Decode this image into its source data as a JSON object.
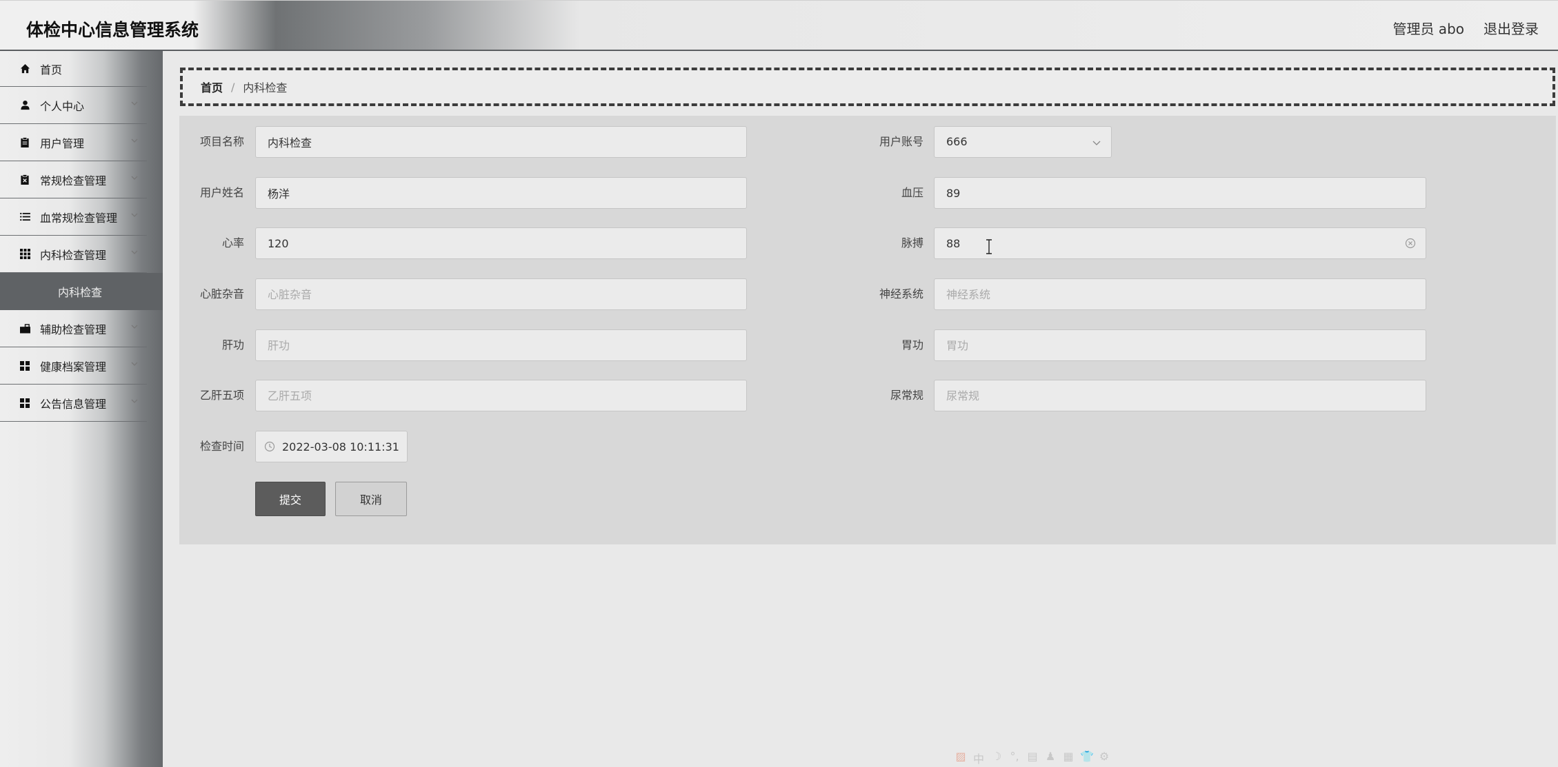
{
  "header": {
    "title": "体检中心信息管理系统",
    "user_label": "管理员 abo",
    "logout_label": "退出登录"
  },
  "sidebar": {
    "items": [
      {
        "label": "首页",
        "icon": "home-icon"
      },
      {
        "label": "个人中心",
        "icon": "user-icon"
      },
      {
        "label": "用户管理",
        "icon": "clipboard-icon"
      },
      {
        "label": "常规检查管理",
        "icon": "clipboard-x-icon"
      },
      {
        "label": "血常规检查管理",
        "icon": "list-icon"
      },
      {
        "label": "内科检查管理",
        "icon": "grid-icon"
      },
      {
        "label": "辅助检查管理",
        "icon": "briefcase-icon"
      },
      {
        "label": "健康档案管理",
        "icon": "apps-icon"
      },
      {
        "label": "公告信息管理",
        "icon": "apps-icon"
      }
    ],
    "active_sub": "内科检查"
  },
  "breadcrumb": {
    "home": "首页",
    "separator": "/",
    "current": "内科检查"
  },
  "form": {
    "project_name": {
      "label": "项目名称",
      "value": "内科检查"
    },
    "user_account": {
      "label": "用户账号",
      "value": "666"
    },
    "user_name": {
      "label": "用户姓名",
      "value": "杨洋"
    },
    "blood_pressure": {
      "label": "血压",
      "value": "89"
    },
    "heart_rate": {
      "label": "心率",
      "value": "120"
    },
    "pulse": {
      "label": "脉搏",
      "value": "88"
    },
    "heart_murmur": {
      "label": "心脏杂音",
      "placeholder": "心脏杂音"
    },
    "nervous_system": {
      "label": "神经系统",
      "placeholder": "神经系统"
    },
    "liver_function": {
      "label": "肝功",
      "placeholder": "肝功"
    },
    "stomach_function": {
      "label": "胃功",
      "placeholder": "胃功"
    },
    "hepatitis_b": {
      "label": "乙肝五项",
      "placeholder": "乙肝五项"
    },
    "urine_routine": {
      "label": "尿常规",
      "placeholder": "尿常规"
    },
    "check_time": {
      "label": "检查时间",
      "value": "2022-03-08 10:11:31"
    },
    "submit_label": "提交",
    "cancel_label": "取消"
  },
  "ime_toolbar": [
    "中",
    "☽",
    "°,",
    "▤",
    "♟",
    "▦",
    "👕",
    "⚙"
  ]
}
